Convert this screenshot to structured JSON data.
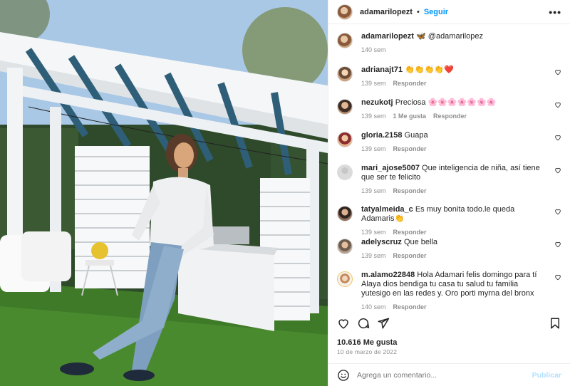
{
  "post": {
    "username": "adamarilopezt",
    "follow_label": "Seguir",
    "more_label": "•••",
    "caption": {
      "username": "adamarilopezt",
      "text": "🦋 @adamarilopez",
      "time": "140 sem"
    },
    "likes": "10.616 Me gusta",
    "date": "10 de marzo de 2022"
  },
  "comments": [
    {
      "user": "adrianajt71",
      "text": "👏👏👏👏❤️",
      "time": "139 sem",
      "likes": "",
      "reply": "Responder"
    },
    {
      "user": "nezukotj",
      "text": "Preciosa 🌸🌸🌸🌸🌸🌸🌸",
      "time": "139 sem",
      "likes": "1 Me gusta",
      "reply": "Responder"
    },
    {
      "user": "gloria.2158",
      "text": "Guapa",
      "time": "139 sem",
      "likes": "",
      "reply": "Responder"
    },
    {
      "user": "mari_ajose5007",
      "text": "Que inteligencia de niña, así tiene que ser te felicito",
      "time": "139 sem",
      "likes": "",
      "reply": "Responder"
    },
    {
      "user": "tatyalmeida_c",
      "text": "Es muy bonita todo.le queda Adamaris👏",
      "time": "139 sem",
      "likes": "",
      "reply": "Responder"
    },
    {
      "user": "adelyscruz",
      "text": "Que bella",
      "time": "139 sem",
      "likes": "",
      "reply": "Responder"
    },
    {
      "user": "m.alamo22848",
      "text": "Hola Adamari felis domingo para tí Alaya dios bendiga tu casa tu salud tu familia yutesigo en las redes y. Oro porti myrna del bronx",
      "time": "140 sem",
      "likes": "",
      "reply": "Responder"
    }
  ],
  "composer": {
    "placeholder": "Agrega un comentario...",
    "post_label": "Publicar"
  },
  "icons": {
    "like": "heart-icon",
    "comment": "comment-icon",
    "share": "share-icon",
    "save": "bookmark-icon",
    "emoji": "emoji-icon"
  },
  "colors": {
    "link": "#0095f6",
    "muted": "#8e8e8e",
    "post_disabled": "#b2dffc"
  }
}
